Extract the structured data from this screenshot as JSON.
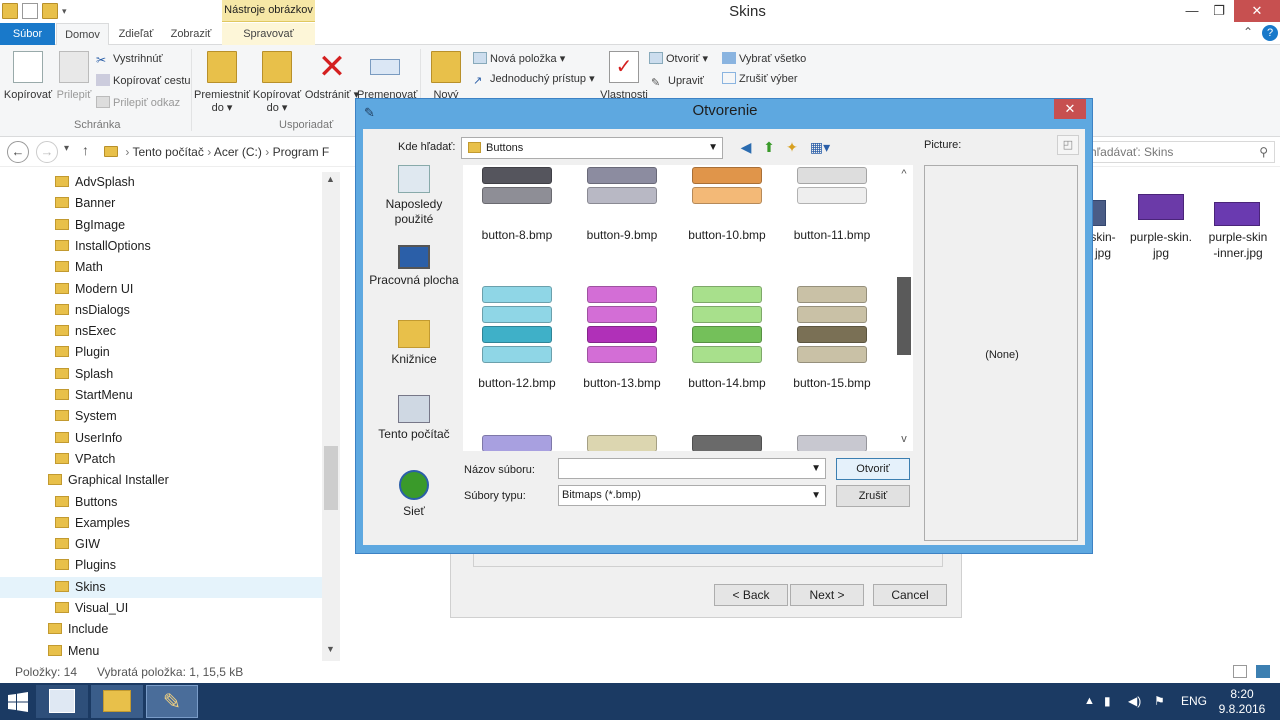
{
  "window": {
    "title": "Skins",
    "tools_context_label": "Nástroje obrázkov"
  },
  "tabs": {
    "file": "Súbor",
    "home": "Domov",
    "share": "Zdieľať",
    "view": "Zobraziť",
    "manage": "Spravovať"
  },
  "ribbon": {
    "copy": "Kopírovať",
    "paste": "Prilepiť",
    "cut": "Vystrihnúť",
    "copy_path": "Kopírovať cestu",
    "paste_shortcut": "Prilepiť odkaz",
    "group_clipboard": "Schránka",
    "move_to_line1": "Premiestniť",
    "move_to_line2": "do",
    "copy_to_line1": "Kopírovať",
    "copy_to_line2": "do",
    "delete": "Odstrániť",
    "rename": "Premenovať",
    "group_organize": "Usporiadať",
    "new_folder": "Nový",
    "new_item": "Nová položka",
    "easy_access": "Jednoduchý prístup",
    "properties": "Vlastnosti",
    "open": "Otvoriť",
    "edit": "Upraviť",
    "select_all": "Vybrať všetko",
    "select_none": "Zrušiť výber"
  },
  "address": {
    "path": [
      "Tento počítač",
      "Acer (C:)",
      "Program F"
    ],
    "search_placeholder": "hľadávať: Skins"
  },
  "navtree": [
    {
      "label": "AdvSplash",
      "indent": 1
    },
    {
      "label": "Banner",
      "indent": 1
    },
    {
      "label": "BgImage",
      "indent": 1
    },
    {
      "label": "InstallOptions",
      "indent": 1
    },
    {
      "label": "Math",
      "indent": 1
    },
    {
      "label": "Modern UI",
      "indent": 1
    },
    {
      "label": "nsDialogs",
      "indent": 1
    },
    {
      "label": "nsExec",
      "indent": 1
    },
    {
      "label": "Plugin",
      "indent": 1
    },
    {
      "label": "Splash",
      "indent": 1
    },
    {
      "label": "StartMenu",
      "indent": 1
    },
    {
      "label": "System",
      "indent": 1
    },
    {
      "label": "UserInfo",
      "indent": 1
    },
    {
      "label": "VPatch",
      "indent": 1
    },
    {
      "label": "Graphical Installer",
      "indent": 0
    },
    {
      "label": "Buttons",
      "indent": 1
    },
    {
      "label": "Examples",
      "indent": 1
    },
    {
      "label": "GIW",
      "indent": 1
    },
    {
      "label": "Plugins",
      "indent": 1
    },
    {
      "label": "Skins",
      "indent": 1,
      "selected": true
    },
    {
      "label": "Visual_UI",
      "indent": 1
    },
    {
      "label": "Include",
      "indent": 0
    },
    {
      "label": "Menu",
      "indent": 0
    }
  ],
  "files": [
    {
      "line1": "skin-",
      "line2": "jpg"
    },
    {
      "line1": "purple-skin.",
      "line2": "jpg"
    },
    {
      "line1": "purple-skin",
      "line2": "-inner.jpg"
    }
  ],
  "wizard": {
    "back": "< Back",
    "next": "Next >",
    "cancel": "Cancel"
  },
  "status": {
    "items": "Položky: 14",
    "selected": "Vybratá položka: 1, 15,5 kB"
  },
  "taskbar": {
    "lang": "ENG",
    "time": "8:20",
    "date": "9.8.2016"
  },
  "dialog": {
    "title": "Otvorenie",
    "look_in_label": "Kde hľadať:",
    "look_in_value": "Buttons",
    "places": [
      "Naposledy použité",
      "Pracovná plocha",
      "Knižnice",
      "Tento počítač",
      "Sieť"
    ],
    "files_row1": [
      "button-8.bmp",
      "button-9.bmp",
      "button-10.bmp",
      "button-11.bmp"
    ],
    "files_row2": [
      "button-12.bmp",
      "button-13.bmp",
      "button-14.bmp",
      "button-15.bmp"
    ],
    "filename_label": "Názov súboru:",
    "filename_value": "",
    "filetype_label": "Súbory typu:",
    "filetype_value": "Bitmaps (*.bmp)",
    "open_button": "Otvoriť",
    "cancel_button": "Zrušiť",
    "preview_label": "Picture:",
    "preview_none": "(None)"
  },
  "colors": {
    "accent": "#1979ca",
    "dialog_frame": "#5ea8e0",
    "close_red": "#c75050",
    "taskbar": "#1b3a63"
  }
}
